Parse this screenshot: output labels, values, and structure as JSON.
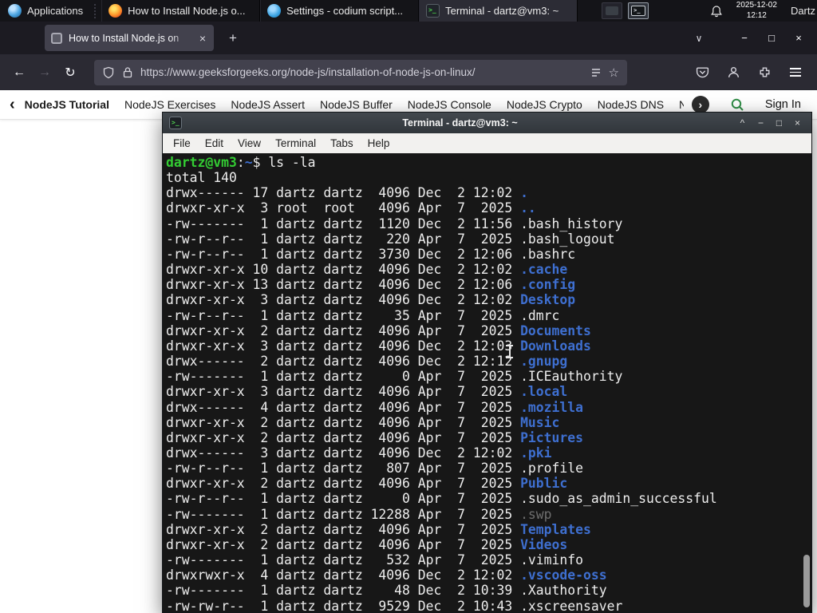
{
  "colors": {
    "accent_green": "#2f8d46",
    "prompt_green": "#33cc33",
    "dir_blue": "#3e6fd0",
    "terminal_bg": "#171717",
    "panel_bg": "#141418",
    "toolbar_bg": "#2b2a33",
    "tabbar_bg": "#1c1b22",
    "active_tab_bg": "#42414d",
    "titlebar_bg": "#42484e",
    "menubar_bg": "#f2f1ef"
  },
  "panel": {
    "applications_label": "Applications",
    "tasks": [
      {
        "icon": "firefox",
        "title": "How to Install Node.js o...",
        "active": false
      },
      {
        "icon": "codium",
        "title": "Settings - codium script...",
        "active": false
      },
      {
        "icon": "terminal",
        "title": "Terminal - dartz@vm3: ~",
        "active": true
      }
    ],
    "clock_date": "2025-12-02",
    "clock_time": "12:12",
    "user_label": "Dartz"
  },
  "browser": {
    "tab_title": "How to Install Node.js on",
    "url": "https://www.geeksforgeeks.org/node-js/installation-of-node-js-on-linux/",
    "glyphs": {
      "new_tab": "+",
      "close_tab": "×",
      "list_tabs": "∨",
      "back": "←",
      "forward": "→",
      "reload": "↻",
      "star": "☆",
      "minimize": "−",
      "maximize": "□",
      "close": "×"
    }
  },
  "gfg_nav": {
    "scroll_left": "‹",
    "scroll_right": "›",
    "items": [
      "NodeJS Tutorial",
      "NodeJS Exercises",
      "NodeJS Assert",
      "NodeJS Buffer",
      "NodeJS Console",
      "NodeJS Crypto",
      "NodeJS DNS",
      "Node"
    ],
    "sign_in_label": "Sign In"
  },
  "terminal": {
    "window_title": "Terminal - dartz@vm3: ~",
    "controls": {
      "shade": "^",
      "minimize": "−",
      "maximize": "□",
      "close": "×"
    },
    "menu": [
      "File",
      "Edit",
      "View",
      "Terminal",
      "Tabs",
      "Help"
    ],
    "prompt_user": "dartz@vm3",
    "prompt_sep": ":",
    "prompt_path": "~",
    "prompt_symbol": "$",
    "command": "ls -la",
    "total_line": "total 140",
    "entries": [
      {
        "meta": "drwx------ 17 dartz dartz  4096 Dec  2 12:02 ",
        "name": ".",
        "kind": "dir"
      },
      {
        "meta": "drwxr-xr-x  3 root  root   4096 Apr  7  2025 ",
        "name": "..",
        "kind": "dir"
      },
      {
        "meta": "-rw-------  1 dartz dartz  1120 Dec  2 11:56 ",
        "name": ".bash_history",
        "kind": "file"
      },
      {
        "meta": "-rw-r--r--  1 dartz dartz   220 Apr  7  2025 ",
        "name": ".bash_logout",
        "kind": "file"
      },
      {
        "meta": "-rw-r--r--  1 dartz dartz  3730 Dec  2 12:06 ",
        "name": ".bashrc",
        "kind": "file"
      },
      {
        "meta": "drwxr-xr-x 10 dartz dartz  4096 Dec  2 12:02 ",
        "name": ".cache",
        "kind": "dir"
      },
      {
        "meta": "drwxr-xr-x 13 dartz dartz  4096 Dec  2 12:06 ",
        "name": ".config",
        "kind": "dir"
      },
      {
        "meta": "drwxr-xr-x  3 dartz dartz  4096 Dec  2 12:02 ",
        "name": "Desktop",
        "kind": "dir"
      },
      {
        "meta": "-rw-r--r--  1 dartz dartz    35 Apr  7  2025 ",
        "name": ".dmrc",
        "kind": "file"
      },
      {
        "meta": "drwxr-xr-x  2 dartz dartz  4096 Apr  7  2025 ",
        "name": "Documents",
        "kind": "dir"
      },
      {
        "meta": "drwxr-xr-x  3 dartz dartz  4096 Dec  2 12:03 ",
        "name": "Downloads",
        "kind": "dir"
      },
      {
        "meta": "drwx------  2 dartz dartz  4096 Dec  2 12:12 ",
        "name": ".gnupg",
        "kind": "dir"
      },
      {
        "meta": "-rw-------  1 dartz dartz     0 Apr  7  2025 ",
        "name": ".ICEauthority",
        "kind": "file"
      },
      {
        "meta": "drwxr-xr-x  3 dartz dartz  4096 Apr  7  2025 ",
        "name": ".local",
        "kind": "dir"
      },
      {
        "meta": "drwx------  4 dartz dartz  4096 Apr  7  2025 ",
        "name": ".mozilla",
        "kind": "dir"
      },
      {
        "meta": "drwxr-xr-x  2 dartz dartz  4096 Apr  7  2025 ",
        "name": "Music",
        "kind": "dir"
      },
      {
        "meta": "drwxr-xr-x  2 dartz dartz  4096 Apr  7  2025 ",
        "name": "Pictures",
        "kind": "dir"
      },
      {
        "meta": "drwx------  3 dartz dartz  4096 Dec  2 12:02 ",
        "name": ".pki",
        "kind": "dir"
      },
      {
        "meta": "-rw-r--r--  1 dartz dartz   807 Apr  7  2025 ",
        "name": ".profile",
        "kind": "file"
      },
      {
        "meta": "drwxr-xr-x  2 dartz dartz  4096 Apr  7  2025 ",
        "name": "Public",
        "kind": "dir"
      },
      {
        "meta": "-rw-r--r--  1 dartz dartz     0 Apr  7  2025 ",
        "name": ".sudo_as_admin_successful",
        "kind": "file"
      },
      {
        "meta": "-rw-------  1 dartz dartz 12288 Apr  7  2025 ",
        "name": ".swp",
        "kind": "dim"
      },
      {
        "meta": "drwxr-xr-x  2 dartz dartz  4096 Apr  7  2025 ",
        "name": "Templates",
        "kind": "dir"
      },
      {
        "meta": "drwxr-xr-x  2 dartz dartz  4096 Apr  7  2025 ",
        "name": "Videos",
        "kind": "dir"
      },
      {
        "meta": "-rw-------  1 dartz dartz   532 Apr  7  2025 ",
        "name": ".viminfo",
        "kind": "file"
      },
      {
        "meta": "drwxrwxr-x  4 dartz dartz  4096 Dec  2 12:02 ",
        "name": ".vscode-oss",
        "kind": "dir"
      },
      {
        "meta": "-rw-------  1 dartz dartz    48 Dec  2 10:39 ",
        "name": ".Xauthority",
        "kind": "file"
      },
      {
        "meta": "-rw-rw-r--  1 dartz dartz  9529 Dec  2 10:43 ",
        "name": ".xscreensaver",
        "kind": "file"
      }
    ]
  }
}
